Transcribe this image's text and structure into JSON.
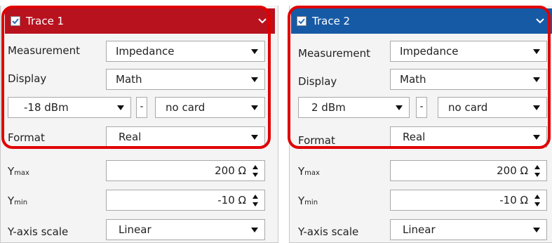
{
  "panels": [
    {
      "title": "Trace 1",
      "checked": true,
      "header_color": "#b8121f",
      "measurement_label": "Measurement",
      "measurement_value": "Impedance",
      "display_label": "Display",
      "display_value": "Math",
      "power_value": "-18 dBm",
      "minus_label": "-",
      "card_value": "no card",
      "format_label": "Format",
      "format_value": "Real",
      "ymax_label": "Y",
      "ymax_sub": "max",
      "ymax_value": "200 Ω",
      "ymin_label": "Y",
      "ymin_sub": "min",
      "ymin_value": "-10 Ω",
      "yscale_label": "Y-axis scale",
      "yscale_value": "Linear"
    },
    {
      "title": "Trace 2",
      "checked": true,
      "header_color": "#165aa6",
      "measurement_label": "Measurement",
      "measurement_value": "Impedance",
      "display_label": "Display",
      "display_value": "Math",
      "power_value": "2 dBm",
      "minus_label": "-",
      "card_value": "no card",
      "format_label": "Format",
      "format_value": "Real",
      "ymax_label": "Y",
      "ymax_sub": "max",
      "ymax_value": "200 Ω",
      "ymin_label": "Y",
      "ymin_sub": "min",
      "ymin_value": "-10 Ω",
      "yscale_label": "Y-axis scale",
      "yscale_value": "Linear"
    }
  ],
  "icons": {
    "checkbox": "checkbox-checked-icon",
    "chevron": "chevron-down-icon",
    "dropdown": "caret-down-icon",
    "spinner": "spinner-arrows-icon"
  },
  "highlight_color": "#e00000"
}
